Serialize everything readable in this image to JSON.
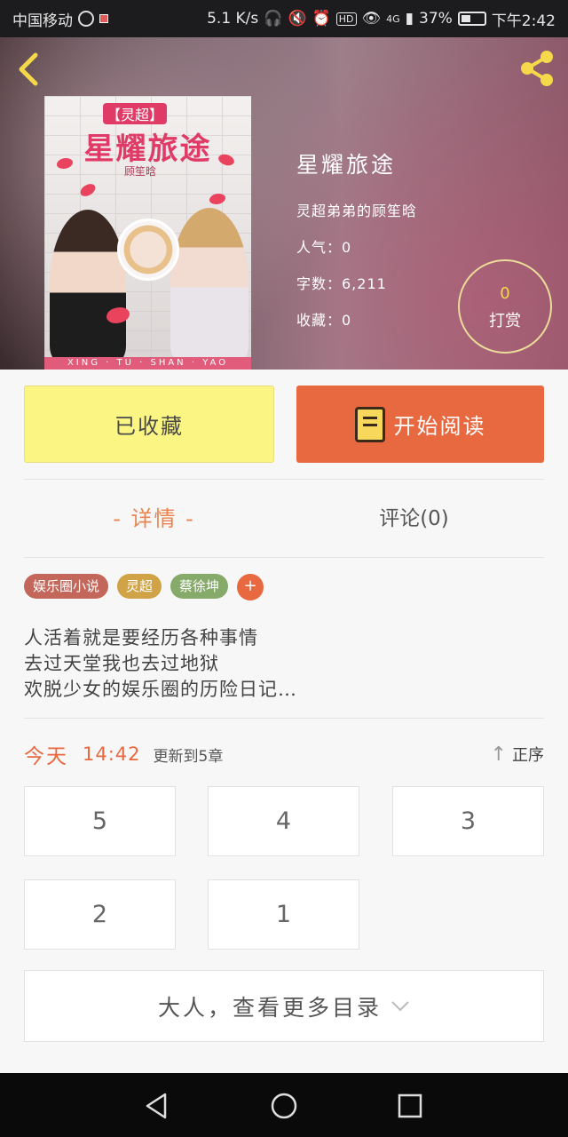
{
  "status_bar": {
    "carrier": "中国移动",
    "speed": "5.1 K/s",
    "hd": "HD",
    "network": "4G",
    "battery": "37%",
    "time": "下午2:42"
  },
  "book": {
    "cover": {
      "tag": "【灵超】",
      "title": "星耀旅途",
      "author": "顾笙晗",
      "footer": "XING · TU · SHAN · YAO"
    },
    "title": "星耀旅途",
    "author": "灵超弟弟的顾笙晗",
    "popularity": "人气：0",
    "word_count": "字数：6,211",
    "favorites": "收藏：0",
    "reward_count": "0",
    "reward_label": "打赏"
  },
  "actions": {
    "collected_label": "已收藏",
    "read_label": "开始阅读"
  },
  "tabs": {
    "detail": "- 详情 -",
    "comments": "评论(0)"
  },
  "tags": [
    {
      "label": "娱乐圈小说",
      "color": "#c2675a"
    },
    {
      "label": "灵超",
      "color": "#d0a347"
    },
    {
      "label": "蔡徐坤",
      "color": "#86aa6a"
    }
  ],
  "tag_add": "+",
  "description": [
    "人活着就是要经历各种事情",
    "去过天堂我也去过地狱",
    "欢脱少女的娱乐圈的历险日记…"
  ],
  "update": {
    "today": "今天",
    "time": "14:42",
    "text": "更新到5章",
    "sort_label": "正序"
  },
  "chapters": [
    "5",
    "4",
    "3",
    "2",
    "1"
  ],
  "more_label": "大人，查看更多目录",
  "colors": {
    "accent": "#e8683f",
    "collected_bg": "#fbf684",
    "reward_gold": "#f5d94a"
  }
}
